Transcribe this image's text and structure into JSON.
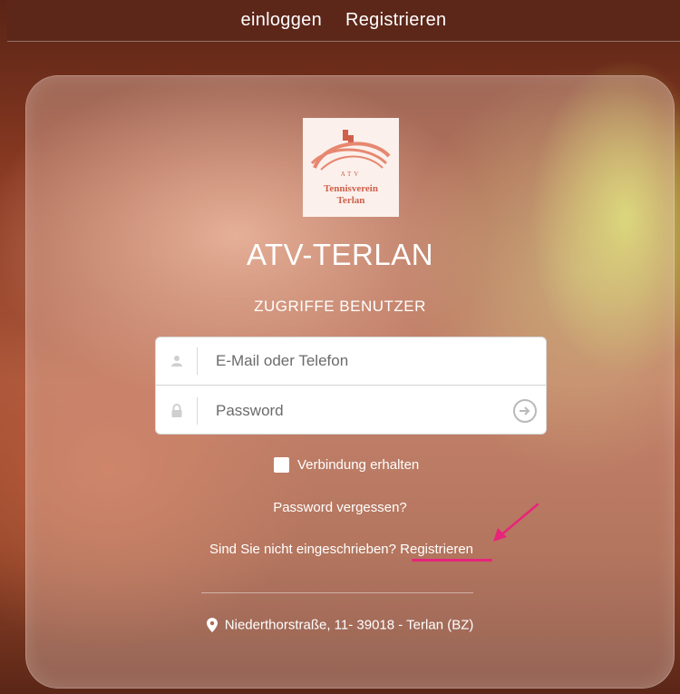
{
  "nav": {
    "login": "einloggen",
    "register": "Registrieren"
  },
  "logo": {
    "line1": "ATV",
    "line2": "Tennisverein",
    "line3": "Terlan",
    "color": "#d0604a"
  },
  "title": "ATV-TERLAN",
  "subtitle": "ZUGRIFFE BENUTZER",
  "form": {
    "email_placeholder": "E-Mail oder Telefon",
    "email_value": "",
    "password_placeholder": "Password",
    "password_value": "",
    "email_icon": "user-icon",
    "password_icon": "lock-icon",
    "submit_icon": "arrow-right-circle-icon"
  },
  "remember": {
    "label": "Verbindung erhalten",
    "checked": false
  },
  "forgot_link": "Password vergessen?",
  "register_prompt": {
    "text": "Sind Sie nicht eingeschrieben?",
    "link": "Registrieren",
    "highlight_color": "#e8247a"
  },
  "address": {
    "icon": "map-marker-icon",
    "text": "Niederthorstraße, 11- 39018 - Terlan (BZ)"
  }
}
